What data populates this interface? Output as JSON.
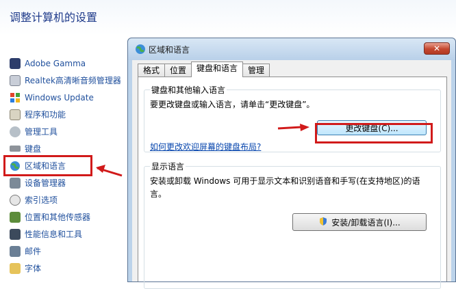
{
  "control_panel": {
    "title": "调整计算机的设置",
    "items": [
      {
        "label": "Adobe Gamma",
        "icon": "adobe-gamma-icon"
      },
      {
        "label": "Realtek高清晰音频管理器",
        "icon": "speaker-icon"
      },
      {
        "label": "Windows Update",
        "icon": "windows-update-icon"
      },
      {
        "label": "程序和功能",
        "icon": "programs-icon"
      },
      {
        "label": "管理工具",
        "icon": "admin-tools-icon"
      },
      {
        "label": "键盘",
        "icon": "keyboard-icon"
      },
      {
        "label": "区域和语言",
        "icon": "globe-icon"
      },
      {
        "label": "设备管理器",
        "icon": "device-manager-icon"
      },
      {
        "label": "索引选项",
        "icon": "indexing-icon"
      },
      {
        "label": "位置和其他传感器",
        "icon": "sensor-icon"
      },
      {
        "label": "性能信息和工具",
        "icon": "performance-icon"
      },
      {
        "label": "邮件",
        "icon": "mail-icon"
      },
      {
        "label": "字体",
        "icon": "fonts-icon"
      }
    ]
  },
  "dialog": {
    "title": "区域和语言",
    "close_label": "✕",
    "tabs": [
      "格式",
      "位置",
      "键盘和语言",
      "管理"
    ],
    "active_tab": "键盘和语言",
    "keyboard_group": {
      "label": "键盘和其他输入语言",
      "description": "要更改键盘或输入语言，请单击“更改键盘”。",
      "change_button": "更改键盘(C)...",
      "help_link": "如何更改欢迎屏幕的键盘布局?"
    },
    "display_group": {
      "label": "显示语言",
      "description_line1": "安装或卸载 Windows 可用于显示文本和识别语音和手写(在支持地区)的语",
      "description_line2": "言。",
      "install_button": "安装/卸载语言(I)..."
    }
  },
  "colors": {
    "highlight": "#d11a1a",
    "link": "#1f4f9c"
  }
}
